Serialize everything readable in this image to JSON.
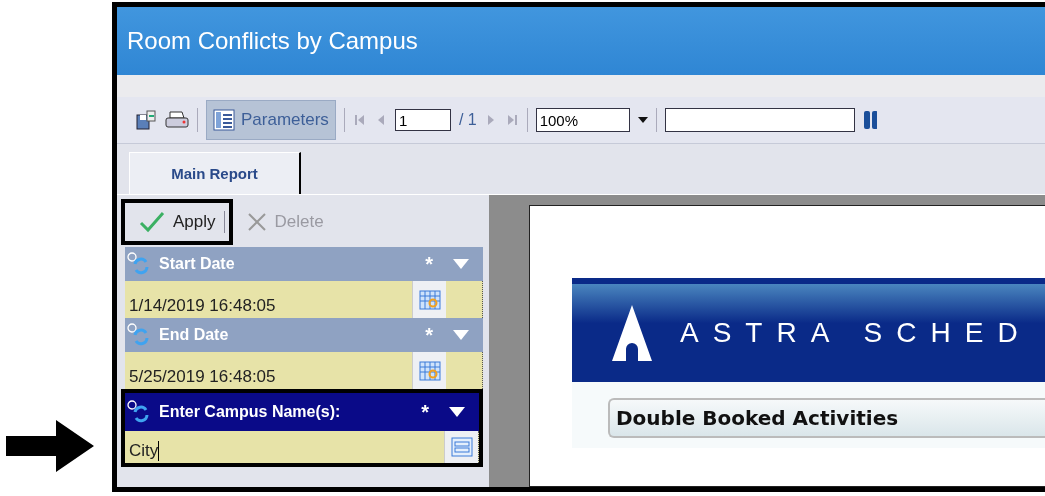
{
  "window": {
    "title": "Room Conflicts by Campus"
  },
  "toolbar": {
    "parameters_button": {
      "label": "Parameters",
      "selected": true
    },
    "page_input": "1",
    "page_count": "/ 1",
    "zoom": "100%"
  },
  "tabs": [
    {
      "label": "Main Report",
      "selected": true
    }
  ],
  "panel_toolbar": [
    {
      "label": "Apply",
      "kind": "apply",
      "disabled": false,
      "highlighted": true
    },
    {
      "label": "Delete",
      "kind": "delete",
      "disabled": true,
      "highlighted": false
    }
  ],
  "parameters": [
    {
      "label": "Start Date",
      "required_mark": "*",
      "value": "1/14/2019 16:48:05",
      "kind": "date",
      "active": false,
      "highlighted": false
    },
    {
      "label": "End Date",
      "required_mark": "*",
      "value": "5/25/2019 16:48:05",
      "kind": "date",
      "active": false,
      "highlighted": false
    },
    {
      "label": "Enter Campus Name(s):",
      "required_mark": "*",
      "value": "City",
      "kind": "text",
      "active": true,
      "highlighted": true
    }
  ],
  "report": {
    "logo_text": "ASTRA SCHED",
    "heading": "Double Booked Activities"
  }
}
